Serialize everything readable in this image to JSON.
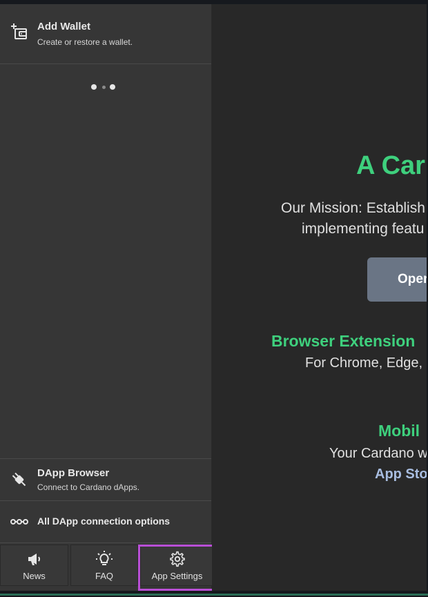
{
  "sidebar": {
    "add_wallet": {
      "title": "Add Wallet",
      "subtitle": "Create or restore a wallet."
    },
    "dapp_browser": {
      "title": "DApp Browser",
      "subtitle": "Connect to Cardano dApps."
    },
    "dapp_options": {
      "title": "All DApp connection options"
    },
    "nav": [
      {
        "label": "News",
        "icon": "megaphone-icon"
      },
      {
        "label": "FAQ",
        "icon": "lightbulb-icon"
      },
      {
        "label": "App Settings",
        "icon": "gear-icon"
      }
    ]
  },
  "main": {
    "hero_title": "A Car",
    "mission_line1": "Our Mission: Establish",
    "mission_line2": "implementing featu",
    "open_button": "Oper",
    "browser_ext_heading": "Browser Extension",
    "browser_ext_text": "For Chrome, Edge,",
    "mobile_heading": "Mobil",
    "mobile_text": "Your Cardano w",
    "app_store_link": "App Sto"
  },
  "colors": {
    "accent_green": "#3ed07d",
    "highlight_purple": "#b94fd6",
    "sidebar_bg": "#363636",
    "main_bg": "#282828",
    "button_bg": "#6a7585",
    "link_blue": "#a8bde0"
  }
}
